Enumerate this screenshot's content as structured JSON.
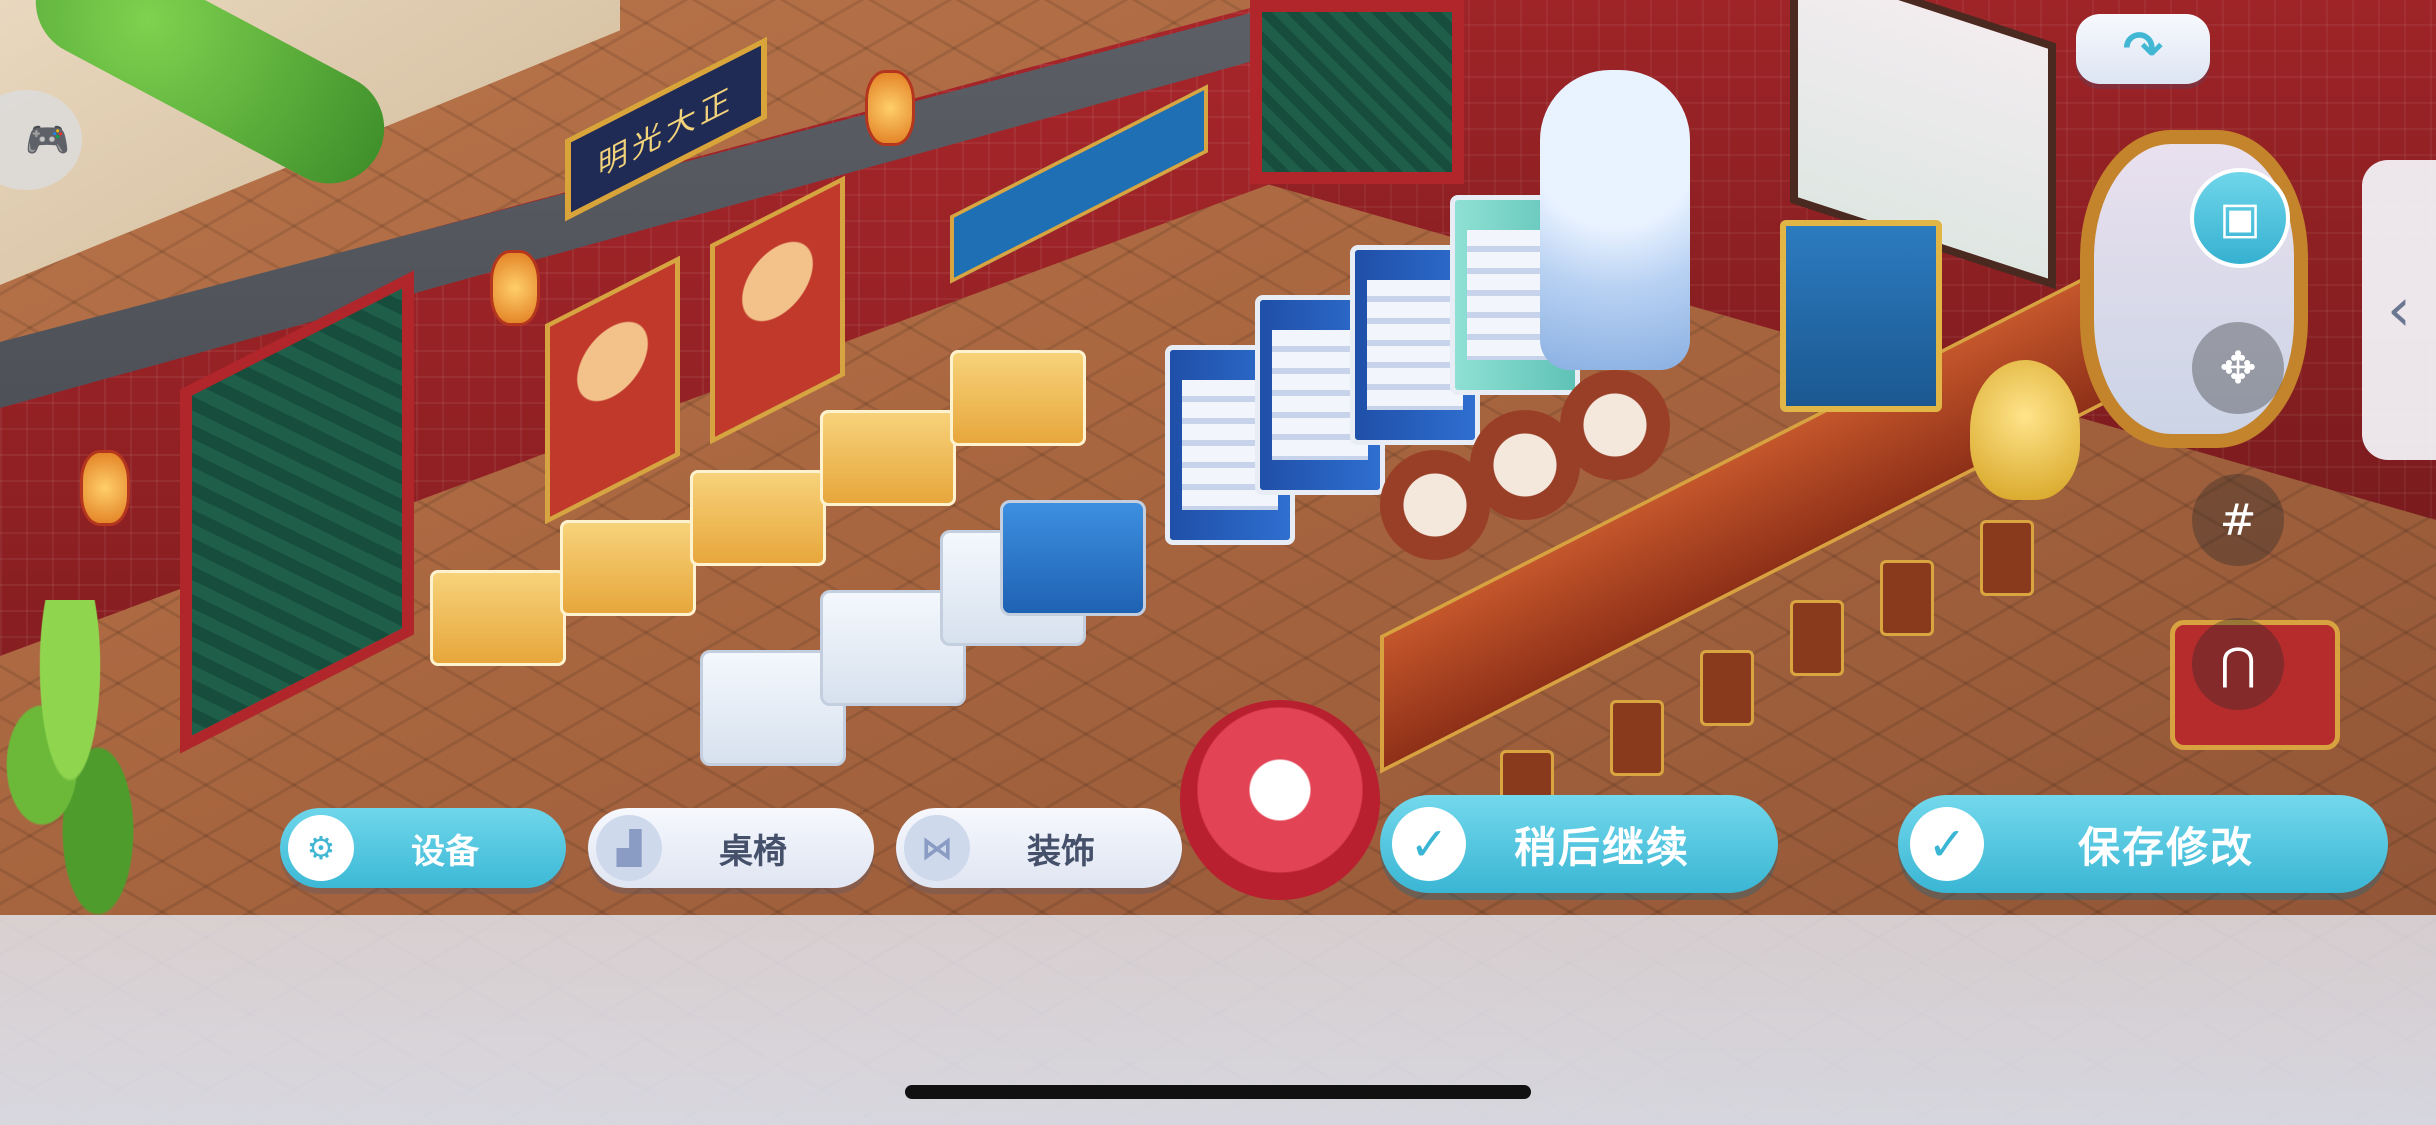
{
  "sign_text": "明光大正",
  "category_tabs": [
    {
      "label": "设备",
      "icon": "mixer-icon",
      "active": true
    },
    {
      "label": "桌椅",
      "icon": "armchair-icon",
      "active": false
    },
    {
      "label": "装饰",
      "icon": "bow-icon",
      "active": false
    }
  ],
  "actions": {
    "later_label": "稍后继续",
    "save_label": "保存修改"
  },
  "icons": {
    "redo": "redo-arrow-icon",
    "storage": "storage-box-icon",
    "move": "move-arrows-icon",
    "grid": "grid-icon",
    "magnet": "magnet-icon",
    "collapse": "chevron-left-icon",
    "gamepad": "gamepad-icon"
  },
  "colors": {
    "accent": "#3cb9d6",
    "wall_red": "#a8262a",
    "floor": "#a7653f"
  }
}
